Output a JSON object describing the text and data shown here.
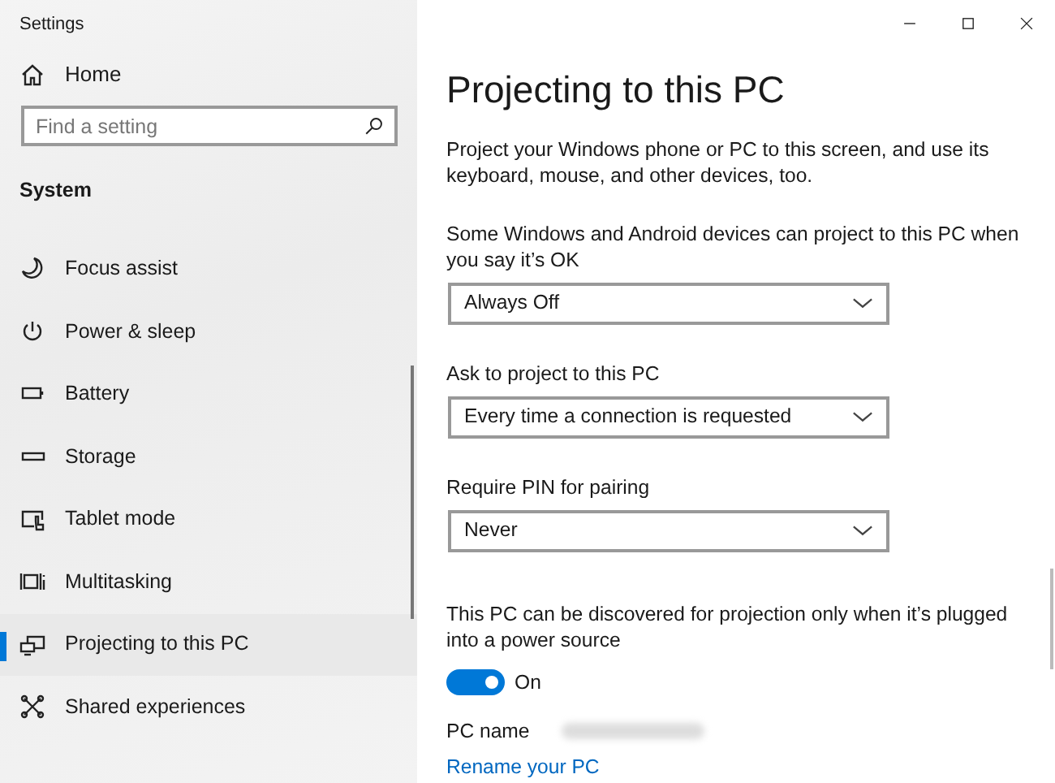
{
  "window": {
    "title": "Settings"
  },
  "sidebar": {
    "home": "Home",
    "search": {
      "placeholder": "Find a setting"
    },
    "section": "System",
    "items": [
      {
        "label": "Focus assist",
        "selected": false
      },
      {
        "label": "Power & sleep",
        "selected": false
      },
      {
        "label": "Battery",
        "selected": false
      },
      {
        "label": "Storage",
        "selected": false
      },
      {
        "label": "Tablet mode",
        "selected": false
      },
      {
        "label": "Multitasking",
        "selected": false
      },
      {
        "label": "Projecting to this PC",
        "selected": true
      },
      {
        "label": "Shared experiences",
        "selected": false
      }
    ]
  },
  "page": {
    "title": "Projecting to this PC",
    "intro": "Project your Windows phone or PC to this screen, and use its keyboard, mouse, and other devices, too.",
    "settings": [
      {
        "label": "Some Windows and Android devices can project to this PC when you say it’s OK",
        "value": "Always Off"
      },
      {
        "label": "Ask to project to this PC",
        "value": "Every time a connection is requested"
      },
      {
        "label": "Require PIN for pairing",
        "value": "Never"
      }
    ],
    "power_note": "This PC can be discovered for projection only when it’s plugged into a power source",
    "toggle": {
      "on": true,
      "label": "On"
    },
    "pc_name_label": "PC name",
    "rename_link": "Rename your PC"
  }
}
